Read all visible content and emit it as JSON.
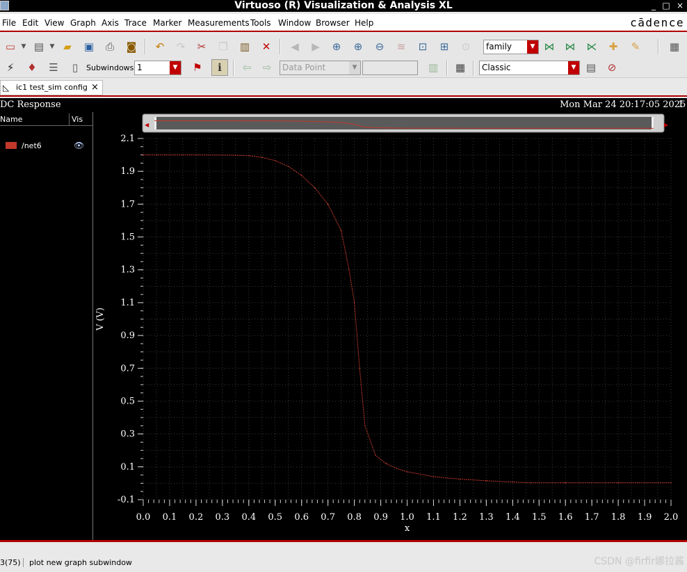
{
  "window": {
    "title": "Virtuoso (R) Visualization & Analysis XL",
    "controls": [
      "_",
      "□",
      "×"
    ]
  },
  "menu": [
    "File",
    "Edit",
    "View",
    "Graph",
    "Axis",
    "Trace",
    "Marker",
    "Measurements",
    "Tools",
    "Window",
    "Browser",
    "Help"
  ],
  "brand": "cādence",
  "toolbar": {
    "family_combo": "family",
    "subwindows_label": "Subwindows:",
    "subwindows_value": "1",
    "data_point_combo": "Data Point",
    "style_combo": "Classic"
  },
  "tab": {
    "label": "ic1 test_sim config",
    "close": "×"
  },
  "graph": {
    "title": "DC Response",
    "timestamp": "Mon Mar 24 20:17:05 2025",
    "page_number": "1",
    "legend_headers": {
      "name": "Name",
      "vis": "Vis"
    },
    "legend_items": [
      {
        "name": "/net6",
        "color": "#c0392b"
      }
    ]
  },
  "status": {
    "left": "3(75)",
    "message": "plot new graph subwindow"
  },
  "watermark": "CSDN @firfir娜拉酱",
  "chart_data": {
    "type": "line",
    "title": "DC Response",
    "xlabel": "x",
    "ylabel": "V (V)",
    "xlim": [
      0.0,
      2.0
    ],
    "ylim": [
      -0.1,
      2.1
    ],
    "x_ticks": [
      "0.0",
      "0.1",
      "0.2",
      "0.3",
      "0.4",
      "0.5",
      "0.6",
      "0.7",
      "0.8",
      "0.9",
      "1.0",
      "1.1",
      "1.2",
      "1.3",
      "1.4",
      "1.5",
      "1.6",
      "1.7",
      "1.8",
      "1.9",
      "2.0"
    ],
    "y_ticks": [
      "2.1",
      "1.9",
      "1.7",
      "1.5",
      "1.3",
      "1.1",
      "0.9",
      "0.7",
      "0.5",
      "0.3",
      "0.1",
      "-0.1"
    ],
    "grid": true,
    "series": [
      {
        "name": "/net6",
        "color": "#c0392b",
        "x": [
          0.0,
          0.2,
          0.35,
          0.4,
          0.45,
          0.5,
          0.55,
          0.6,
          0.65,
          0.7,
          0.75,
          0.78,
          0.8,
          0.82,
          0.84,
          0.88,
          0.92,
          0.96,
          1.0,
          1.1,
          1.2,
          1.3,
          1.4,
          1.47,
          1.6,
          1.8,
          2.0
        ],
        "y": [
          2.0,
          2.0,
          1.998,
          1.995,
          1.985,
          1.965,
          1.93,
          1.875,
          1.8,
          1.7,
          1.54,
          1.3,
          1.1,
          0.7,
          0.35,
          0.17,
          0.12,
          0.09,
          0.07,
          0.04,
          0.025,
          0.015,
          0.007,
          0.003,
          0.003,
          0.003,
          0.003
        ]
      }
    ]
  }
}
